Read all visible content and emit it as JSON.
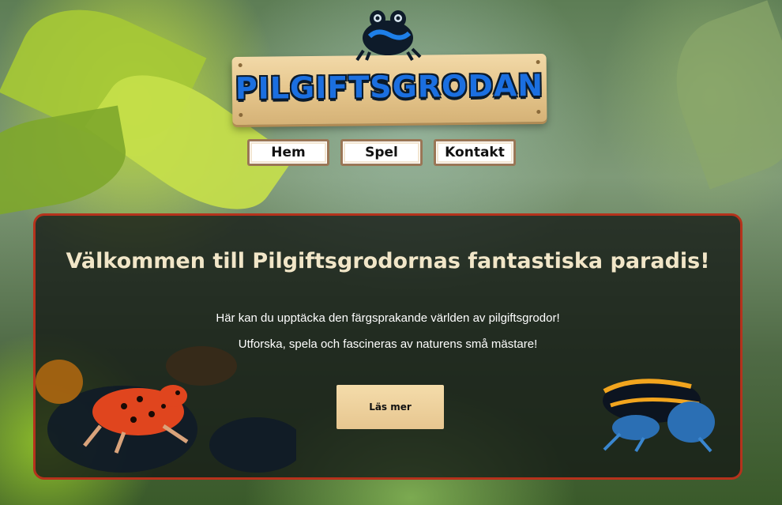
{
  "logo": {
    "title": "PILGIFTSGRODAN",
    "icon": "frog-icon"
  },
  "nav": {
    "items": [
      {
        "label": "Hem"
      },
      {
        "label": "Spel"
      },
      {
        "label": "Kontakt"
      }
    ]
  },
  "hero": {
    "title": "Välkommen till Pilgiftsgrodornas fantastiska paradis!",
    "text1": "Här kan du upptäcka den färgsprakande världen av pilgiftsgrodor!",
    "text2": "Utforska, spela och fascineras av naturens små mästare!",
    "read_more": "Läs mer"
  },
  "colors": {
    "panel_border": "#b5321c",
    "logo_text": "#1b6fe0",
    "wood": "#e7c690"
  }
}
